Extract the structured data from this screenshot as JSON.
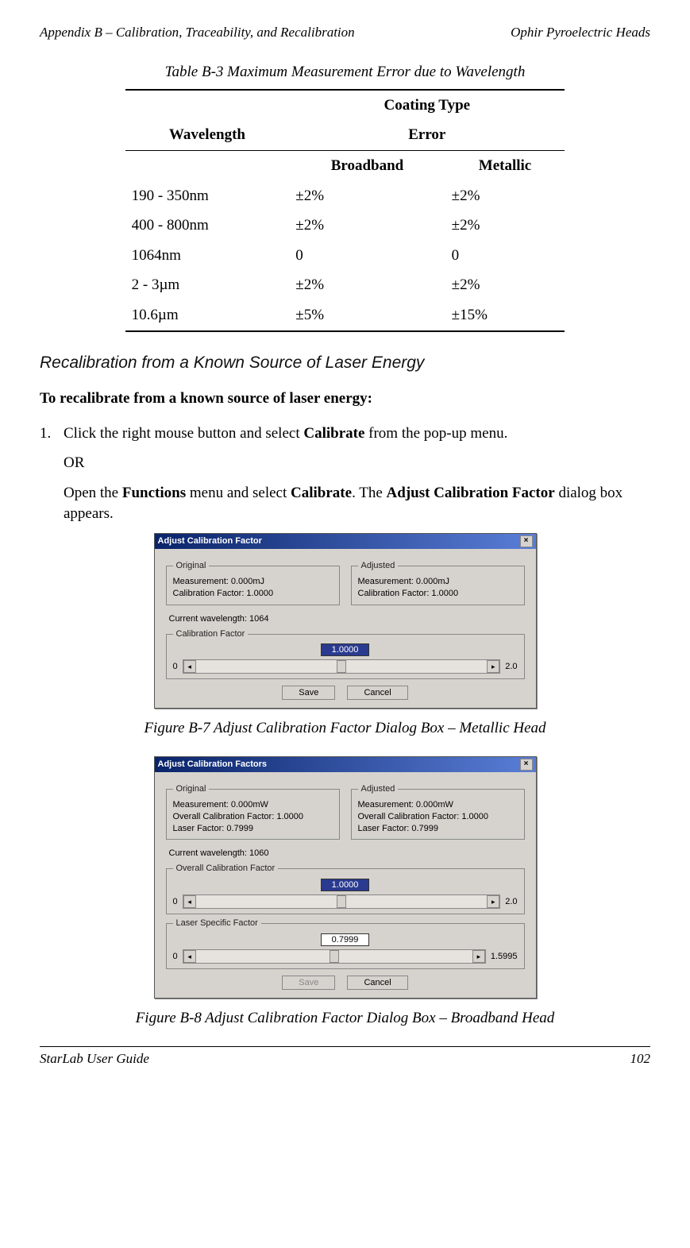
{
  "header": {
    "left": "Appendix B – Calibration, Traceability, and Recalibration",
    "right": "Ophir Pyroelectric Heads"
  },
  "table": {
    "caption": "Table B-3 Maximum Measurement Error due to Wavelength",
    "coating_label": "Coating Type",
    "wavelength_label": "Wavelength",
    "error_label": "Error",
    "col_broadband": "Broadband",
    "col_metallic": "Metallic",
    "rows": [
      {
        "w": "190 - 350nm",
        "b": "±2%",
        "m": "±2%"
      },
      {
        "w": "400 - 800nm",
        "b": "±2%",
        "m": "±2%"
      },
      {
        "w": "1064nm",
        "b": "0",
        "m": "0"
      },
      {
        "w": "2 - 3µm",
        "b": "±2%",
        "m": "±2%"
      },
      {
        "w": "10.6µm",
        "b": "±5%",
        "m": "±15%"
      }
    ]
  },
  "section": {
    "subtitle": "Recalibration from a Known Source of Laser Energy",
    "intro": "To recalibrate from a known source of laser energy:",
    "step_num": "1.",
    "step_line1a": "Click the right mouse button and select ",
    "step_line1_bold": "Calibrate",
    "step_line1b": " from the pop-up menu.",
    "or": "OR",
    "para2a": "Open the ",
    "para2_b1": "Functions",
    "para2b": " menu and select ",
    "para2_b2": "Calibrate",
    "para2c": ". The ",
    "para2_b3": "Adjust Calibration Factor",
    "para2d": " dialog box appears."
  },
  "dialog1": {
    "title": "Adjust Calibration Factor",
    "original_legend": "Original",
    "adjusted_legend": "Adjusted",
    "orig_meas": "Measurement: 0.000mJ",
    "orig_cal": "Calibration Factor: 1.0000",
    "adj_meas": "Measurement: 0.000mJ",
    "adj_cal": "Calibration Factor: 1.0000",
    "current_wl": "Current wavelength: 1064",
    "calfactor_legend": "Calibration Factor",
    "input_val": "1.0000",
    "min": "0",
    "max": "2.0",
    "save": "Save",
    "cancel": "Cancel"
  },
  "fig1_caption": "Figure B-7 Adjust Calibration Factor Dialog Box – Metallic Head",
  "dialog2": {
    "title": "Adjust Calibration Factors",
    "original_legend": "Original",
    "adjusted_legend": "Adjusted",
    "orig_meas": "Measurement: 0.000mW",
    "orig_overall": "Overall Calibration Factor: 1.0000",
    "orig_laser": "Laser Factor: 0.7999",
    "adj_meas": "Measurement: 0.000mW",
    "adj_overall": "Overall Calibration Factor: 1.0000",
    "adj_laser": "Laser Factor: 0.7999",
    "current_wl": "Current wavelength: 1060",
    "overall_legend": "Overall Calibration Factor",
    "overall_val": "1.0000",
    "overall_min": "0",
    "overall_max": "2.0",
    "laser_legend": "Laser Specific Factor",
    "laser_val": "0.7999",
    "laser_min": "0",
    "laser_max": "1.5995",
    "save": "Save",
    "cancel": "Cancel"
  },
  "fig2_caption": "Figure B-8 Adjust Calibration Factor Dialog Box – Broadband Head",
  "footer": {
    "left": "StarLab User Guide",
    "right": "102"
  }
}
